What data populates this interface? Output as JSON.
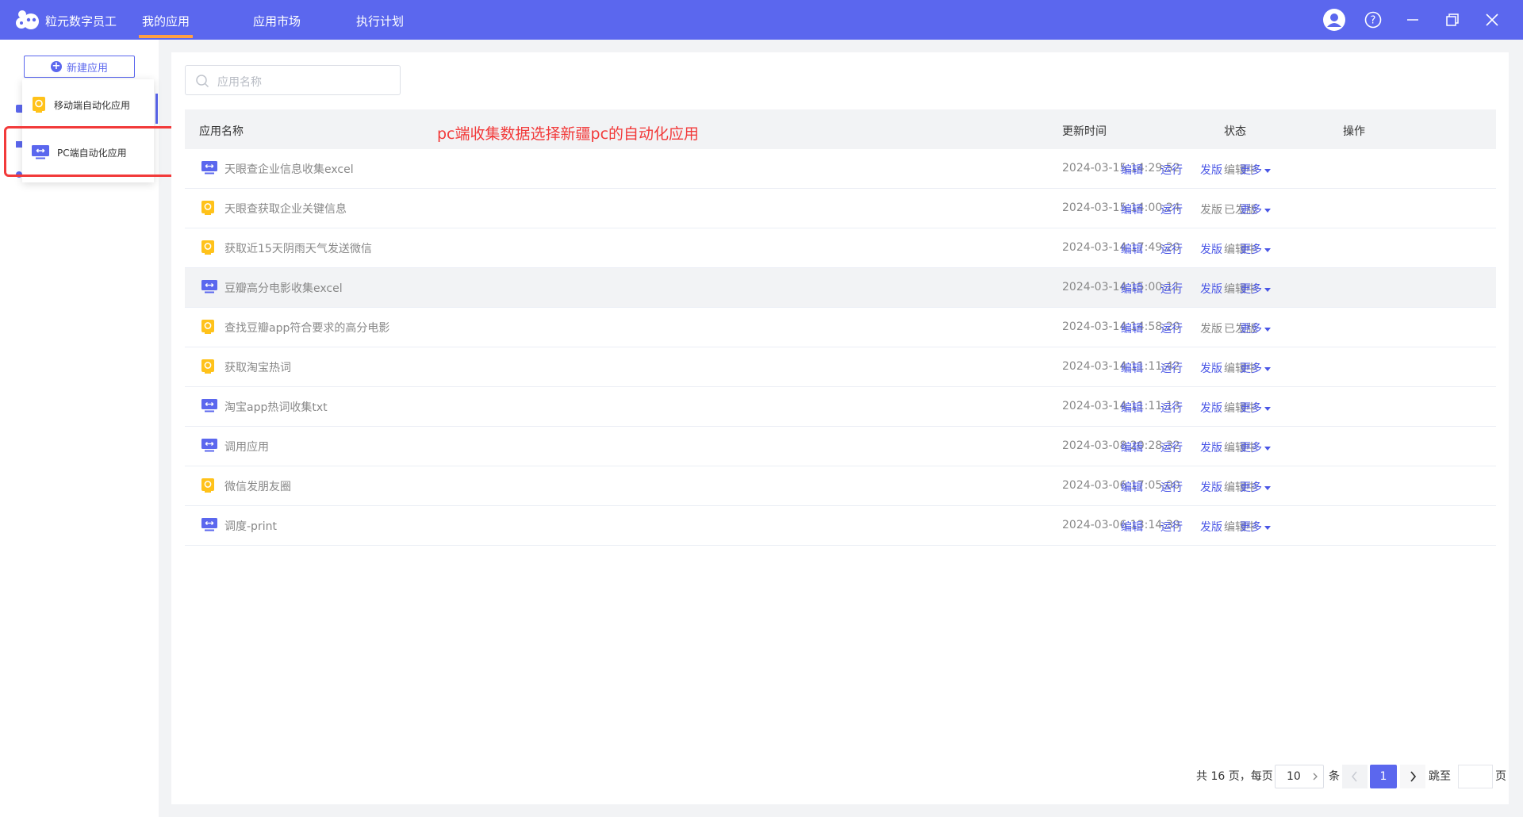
{
  "topbar": {
    "app_name": "粒元数字员工",
    "tabs": [
      {
        "label": "我的应用",
        "active": true
      },
      {
        "label": "应用市场",
        "active": false
      },
      {
        "label": "执行计划",
        "active": false
      }
    ],
    "icons": [
      "user-avatar-icon",
      "help-icon",
      "minimize-icon",
      "restore-icon",
      "close-icon"
    ]
  },
  "sidebar": {
    "new_button_label": "新建应用"
  },
  "dropdown": {
    "items": [
      {
        "label": "移动端自动化应用",
        "icon": "mobile-app-icon"
      },
      {
        "label": "PC端自动化应用",
        "icon": "pc-app-icon"
      }
    ]
  },
  "annotation": "pc端收集数据选择新疆pc的自动化应用",
  "search": {
    "placeholder": "应用名称"
  },
  "table": {
    "headers": {
      "name": "应用名称",
      "time": "更新时间",
      "status": "状态",
      "actions": "操作"
    },
    "action_labels": {
      "edit": "编辑",
      "run": "运行",
      "publish": "发版",
      "more": "更多"
    },
    "rows": [
      {
        "type": "pc",
        "name": "天眼查企业信息收集excel",
        "time": "2024-03-15 14:29:52",
        "status": "编辑中"
      },
      {
        "type": "mobile",
        "name": "天眼查获取企业关键信息",
        "time": "2024-03-15 14:00:24",
        "status": "已发版"
      },
      {
        "type": "mobile",
        "name": "获取近15天阴雨天气发送微信",
        "time": "2024-03-14 17:49:20",
        "status": "编辑中"
      },
      {
        "type": "pc",
        "name": "豆瓣高分电影收集excel",
        "time": "2024-03-14 15:00:11",
        "status": "编辑中"
      },
      {
        "type": "mobile",
        "name": "查找豆瓣app符合要求的高分电影",
        "time": "2024-03-14 14:58:20",
        "status": "已发版"
      },
      {
        "type": "mobile",
        "name": "获取淘宝热词",
        "time": "2024-03-14 11:11:42",
        "status": "编辑中"
      },
      {
        "type": "pc",
        "name": "淘宝app热词收集txt",
        "time": "2024-03-14 11:11:13",
        "status": "编辑中"
      },
      {
        "type": "pc",
        "name": "调用应用",
        "time": "2024-03-08 20:28:32",
        "status": "编辑中"
      },
      {
        "type": "mobile",
        "name": "微信发朋友圈",
        "time": "2024-03-06 17:05:00",
        "status": "编辑中"
      },
      {
        "type": "pc",
        "name": "调度-print",
        "time": "2024-03-06 13:14:39",
        "status": "编辑中"
      }
    ]
  },
  "pagination": {
    "total_text": "共 16 页，每页",
    "page_size": "10",
    "unit": "条",
    "current_page": "1",
    "jump_label": "跳至",
    "page_suffix": "页"
  },
  "colors": {
    "accent": "#5b67ee",
    "link": "#4a56e6",
    "annotation": "#f23a3a",
    "tab_indicator": "#ff9f43"
  }
}
